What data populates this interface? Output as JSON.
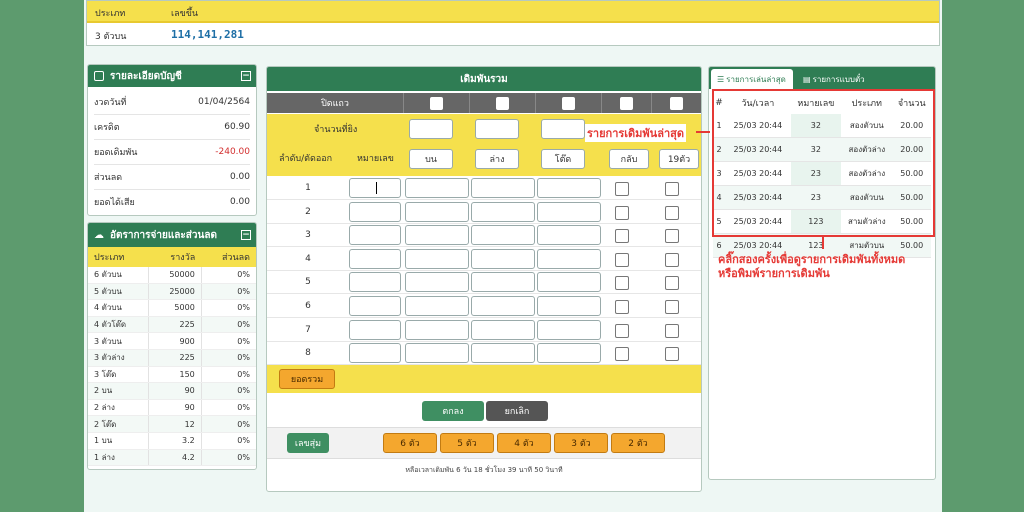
{
  "top_result": {
    "col_type": "ประเภท",
    "col_number": "เลขขึ้น",
    "type": "3 ตัวบน",
    "numbers": "114,141,281"
  },
  "account": {
    "title": "รายละเอียดบัญชี",
    "rows": [
      {
        "label": "งวดวันที่",
        "value": "01/04/2564"
      },
      {
        "label": "เครดิต",
        "value": "60.90"
      },
      {
        "label": "ยอดเดิมพัน",
        "value": "-240.00"
      },
      {
        "label": "ส่วนลด",
        "value": "0.00"
      },
      {
        "label": "ยอดได้เสีย",
        "value": "0.00"
      }
    ]
  },
  "rates": {
    "title": "อัตราการจ่ายและส่วนลด",
    "headers": [
      "ประเภท",
      "รางวัล",
      "ส่วนลด"
    ],
    "rows": [
      [
        "6 ตัวบน",
        "50000",
        "0%"
      ],
      [
        "5 ตัวบน",
        "25000",
        "0%"
      ],
      [
        "4 ตัวบน",
        "5000",
        "0%"
      ],
      [
        "4 ตัวโต๊ด",
        "225",
        "0%"
      ],
      [
        "3 ตัวบน",
        "900",
        "0%"
      ],
      [
        "3 ตัวล่าง",
        "225",
        "0%"
      ],
      [
        "3 โต๊ด",
        "150",
        "0%"
      ],
      [
        "2 บน",
        "90",
        "0%"
      ],
      [
        "2 ล่าง",
        "90",
        "0%"
      ],
      [
        "2 โต๊ด",
        "12",
        "0%"
      ],
      [
        "1 บน",
        "3.2",
        "0%"
      ],
      [
        "1 ล่าง",
        "4.2",
        "0%"
      ]
    ]
  },
  "form": {
    "title": "เดิมพันรวม",
    "close_row_label": "ปิดแถว",
    "amount_label": "จำนวนที่ยิง",
    "order_label": "ลำดับ/ตัดออก",
    "number_label": "หมายเลข",
    "bet_types": [
      "บน",
      "ล่าง",
      "โต๊ด",
      "กลับ",
      "19ตัว"
    ],
    "rows": [
      "1",
      "2",
      "3",
      "4",
      "5",
      "6",
      "7",
      "8"
    ],
    "total_button": "ยอดรวม",
    "ok_button": "ตกลง",
    "cancel_button": "ยกเลิก",
    "random_button": "เลขสุ่ม",
    "digit_buttons": [
      "6 ตัว",
      "5 ตัว",
      "4 ตัว",
      "3 ตัว",
      "2 ตัว"
    ],
    "time_left": "หลือเวลาเดิมพัน 6 วัน 18 ชั่วโมง 39 นาที 50 วินาที"
  },
  "recent": {
    "tab_latest": "รายการเล่นล่าสุด",
    "tab_group": "รายการแบบตั๋ว",
    "headers": [
      "#",
      "วัน/เวลา",
      "หมายเลข",
      "ประเภท",
      "จำนวน"
    ],
    "rows": [
      [
        "1",
        "25/03 20:44",
        "32",
        "สองตัวบน",
        "20.00"
      ],
      [
        "2",
        "25/03 20:44",
        "32",
        "สองตัวล่าง",
        "20.00"
      ],
      [
        "3",
        "25/03 20:44",
        "23",
        "สองตัวล่าง",
        "50.00"
      ],
      [
        "4",
        "25/03 20:44",
        "23",
        "สองตัวบน",
        "50.00"
      ],
      [
        "5",
        "25/03 20:44",
        "123",
        "สามตัวล่าง",
        "50.00"
      ],
      [
        "6",
        "25/03 20:44",
        "123",
        "สามตัวบน",
        "50.00"
      ]
    ]
  },
  "annotations": {
    "latest_label": "รายการเดิมพันล่าสุด",
    "hint_line1": "คลิ๊กสองครั้งเพื่อดูรายการเดิมพันทั้งหมด",
    "hint_line2": "หรือพิมพ์รายการเดิมพัน"
  },
  "colors": {
    "brand_green": "#2f7d54",
    "yellow": "#f5e04c",
    "orange": "#f4a72e",
    "annotation_red": "#e53935",
    "outer_green": "#5d9b6e"
  }
}
